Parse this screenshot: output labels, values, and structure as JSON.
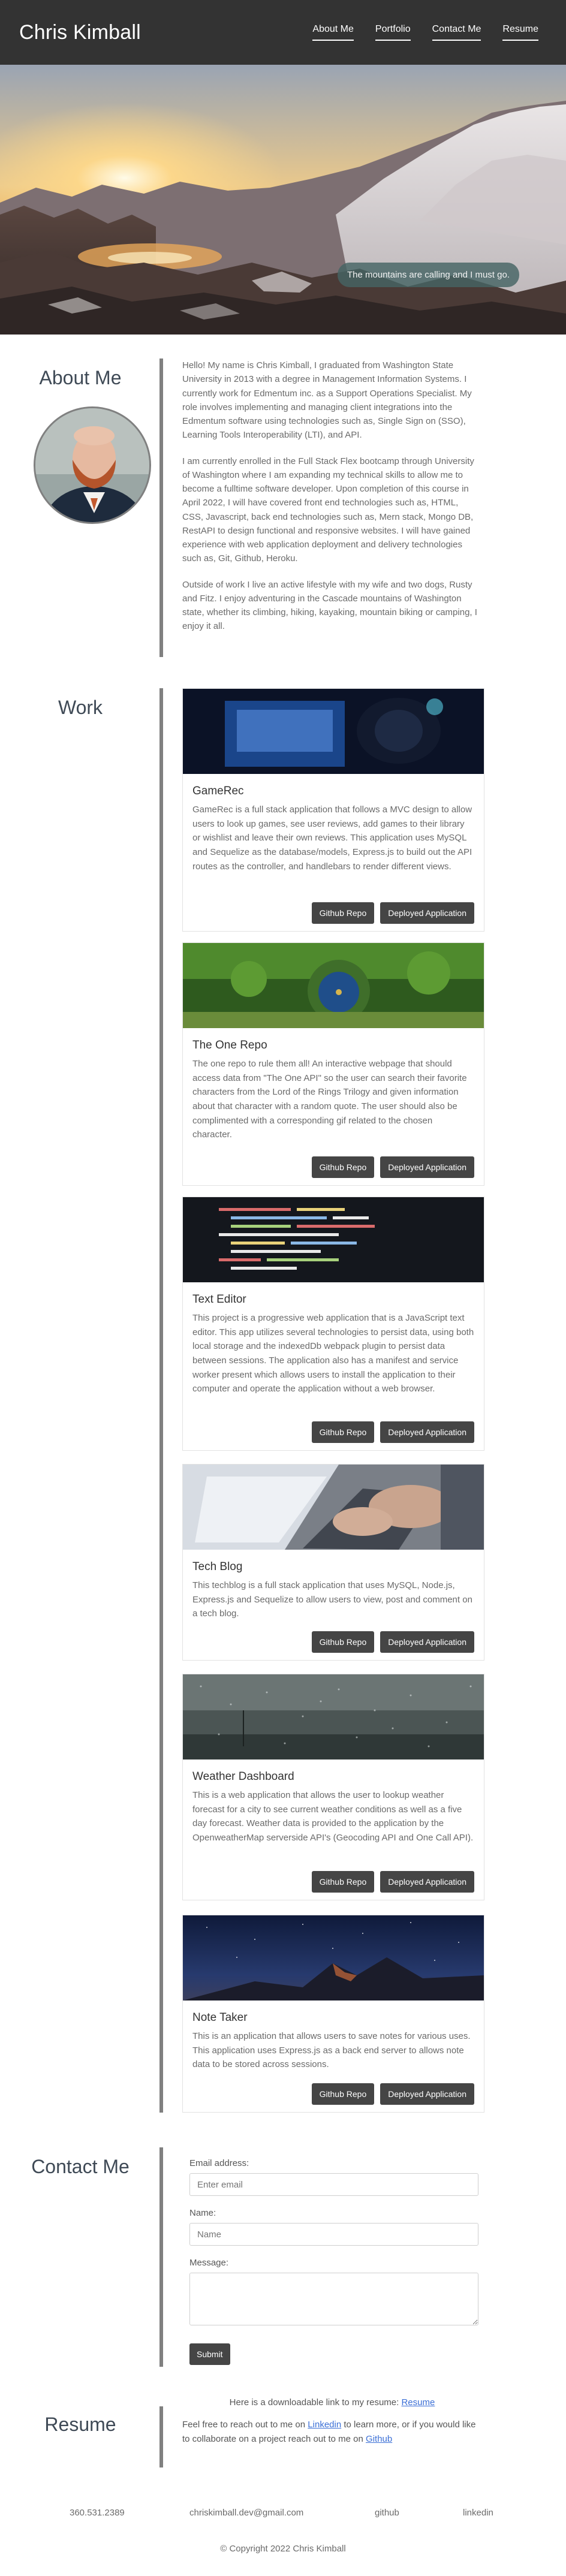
{
  "header": {
    "brand": "Chris Kimball",
    "nav": [
      "About Me",
      "Portfolio",
      "Contact Me",
      "Resume"
    ]
  },
  "hero": {
    "caption": "The mountains are calling and I must go."
  },
  "about": {
    "title": "About Me",
    "paragraphs": [
      "Hello! My name is Chris Kimball, I graduated from Washington State University in 2013 with a degree in Management Information Systems. I currently work for Edmentum inc. as a Support Operations Specialist. My role involves implementing and managing client integrations into the Edmentum software using technologies such as, Single Sign on (SSO), Learning Tools Interoperability (LTI), and API.",
      "I am currently enrolled in the Full Stack Flex bootcamp through University of Washington where I am expanding my technical skills to allow me to become a fulltime software developer. Upon completion of this course in April 2022, I will have covered front end technologies such as, HTML, CSS, Javascript, back end technologies such as, Mern stack, Mongo DB, RestAPI to design functional and responsive websites. I will have gained experience with web application deployment and delivery technologies such as, Git, Github, Heroku.",
      "Outside of work I live an active lifestyle with my wife and two dogs, Rusty and Fitz. I enjoy adventuring in the Cascade mountains of Washington state, whether its climbing, hiking, kayaking, mountain biking or camping, I enjoy it all."
    ]
  },
  "work": {
    "title": "Work",
    "github_label": "Github Repo",
    "deployed_label": "Deployed Application",
    "projects": [
      {
        "title": "GameRec",
        "description": "GameRec is a full stack application that follows a MVC design to allow users to look up games, see user reviews, add games to their library or wishlist and leave their own reviews. This application uses MySQL and Sequelize as the database/models, Express.js to build out the API routes as the controller, and handlebars to render different views."
      },
      {
        "title": "The One Repo",
        "description": "The one repo to rule them all! An interactive webpage that should access data from \"The One API\" so the user can search their favorite characters from the Lord of the Rings Trilogy and given information about that character with a random quote. The user should also be complimented with a corresponding gif related to the chosen character."
      },
      {
        "title": "Text Editor",
        "description": "This project is a progressive web application that is a JavaScript text editor. This app utilizes several technologies to persist data, using both local storage and the indexedDb webpack plugin to persist data between sessions. The application also has a manifest and service worker present which allows users to install the application to their computer and operate the application without a web browser."
      },
      {
        "title": "Tech Blog",
        "description": "This techblog is a full stack application that uses MySQL, Node.js, Express.js and Sequelize to allow users to view, post and comment on a tech blog."
      },
      {
        "title": "Weather Dashboard",
        "description": "This is a web application that allows the user to lookup weather forecast for a city to see current weather conditions as well as a five day forecast. Weather data is provided to the application by the OpenweatherMap serverside API's (Geocoding API and One Call API)."
      },
      {
        "title": "Note Taker",
        "description": "This is an application that allows users to save notes for various uses. This application uses Express.js as a back end server to allows note data to be stored across sessions."
      }
    ]
  },
  "contact": {
    "title": "Contact Me",
    "email_label": "Email address:",
    "email_placeholder": "Enter email",
    "name_label": "Name:",
    "name_placeholder": "Name",
    "message_label": "Message:",
    "submit_label": "Submit"
  },
  "resume": {
    "title": "Resume",
    "download_text": "Here is a downloadable link to my resume: ",
    "download_link": "Resume",
    "reach_text_1": "Feel free to reach out to me on ",
    "linkedin_link": "Linkedin",
    "reach_text_2": " to learn more, or if you would like to collaborate on a project reach out to me on ",
    "github_link": "Github"
  },
  "footer": {
    "phone": "360.531.2389",
    "email": "chriskimball.dev@gmail.com",
    "github": "github",
    "linkedin": "linkedin",
    "copyright": "© Copyright 2022 Chris Kimball"
  },
  "colors": {
    "header_bg": "#333333",
    "rule": "#808080",
    "button_bg": "#454545",
    "link": "#3b6fd6"
  }
}
